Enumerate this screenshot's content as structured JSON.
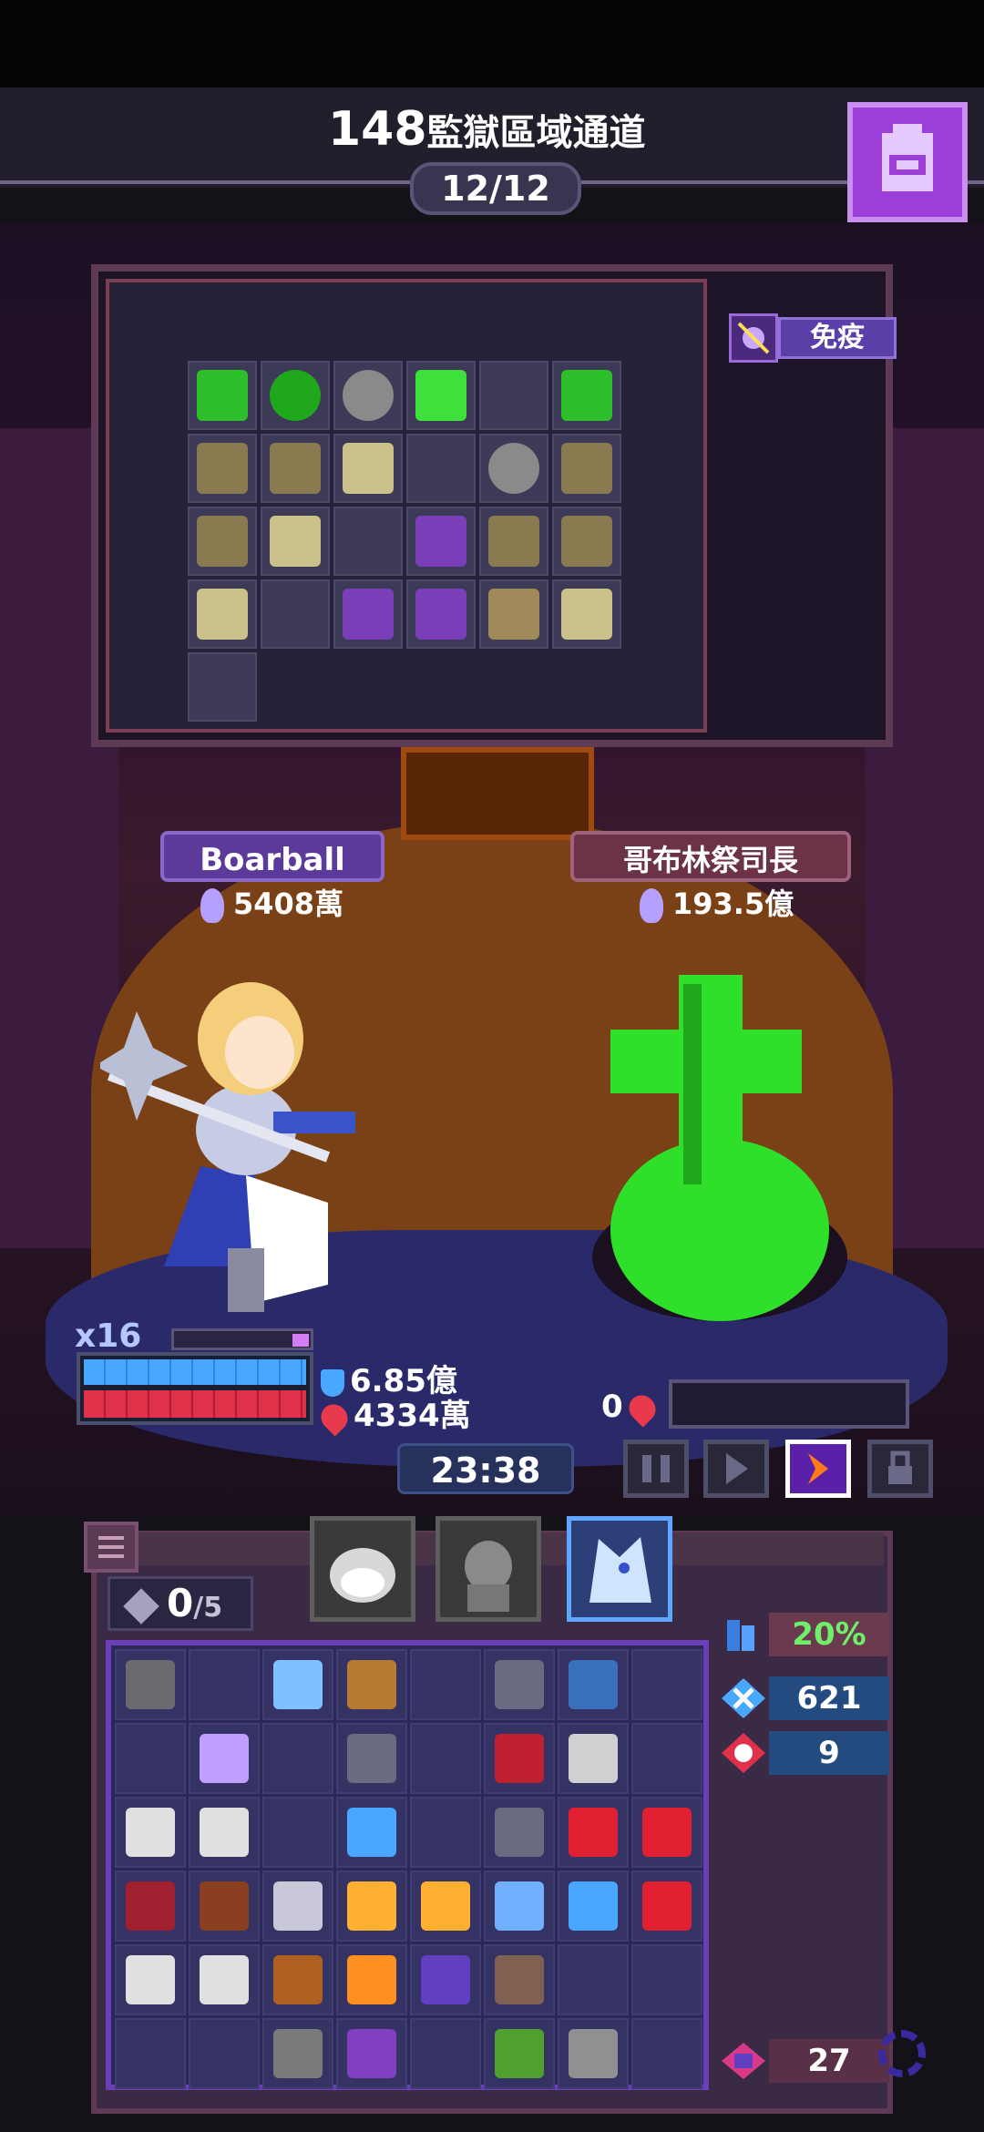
{
  "header": {
    "stage_number": "148",
    "stage_name": "監獄區域通道",
    "wave_progress": "12/12",
    "inventory_button_icon": "backpack-icon"
  },
  "loot_panel": {
    "status_label": "免疫",
    "status_icon": "immune-bug-icon",
    "items": [
      "goblin-dagger-icon",
      "green-slime-icon",
      "ring-icon",
      "green-sword-icon",
      "empty",
      "goblin-dagger-icon",
      "staff-icon",
      "staff-icon",
      "skull-totem-icon",
      "empty",
      "ring-icon",
      "staff-icon",
      "staff-icon",
      "skull-totem-icon",
      "empty",
      "mushroom-icon",
      "staff-icon",
      "staff-icon",
      "skull-totem-icon",
      "empty",
      "mushroom-icon",
      "mushroom-icon",
      "loot-bag-icon",
      "skull-totem-icon",
      "empty"
    ]
  },
  "hero": {
    "name": "Boarball",
    "power": "5408萬",
    "multiplier": "x16",
    "defense": "6.85億",
    "hp": "4334萬"
  },
  "boss": {
    "name": "哥布林祭司長",
    "power": "193.5億",
    "hp": "0"
  },
  "battle": {
    "timer": "23:38",
    "controls": [
      "pause-icon",
      "play-icon",
      "fast-forward-icon",
      "lock-icon"
    ]
  },
  "inventory": {
    "slots_used": "0",
    "slots_total": "/5",
    "character_tabs": [
      "hamster-portrait",
      "knight-portrait",
      "wolf-portrait"
    ],
    "active_tab": 2
  },
  "stats": {
    "drop_rate": "20%",
    "kills": "621",
    "boss_kills": "9",
    "monster_count": "27"
  },
  "colors": {
    "accent_purple": "#9b3fd8",
    "hp_red": "#e0304a",
    "shield_blue": "#4aa7ff",
    "boss_green": "#2ee02a"
  }
}
